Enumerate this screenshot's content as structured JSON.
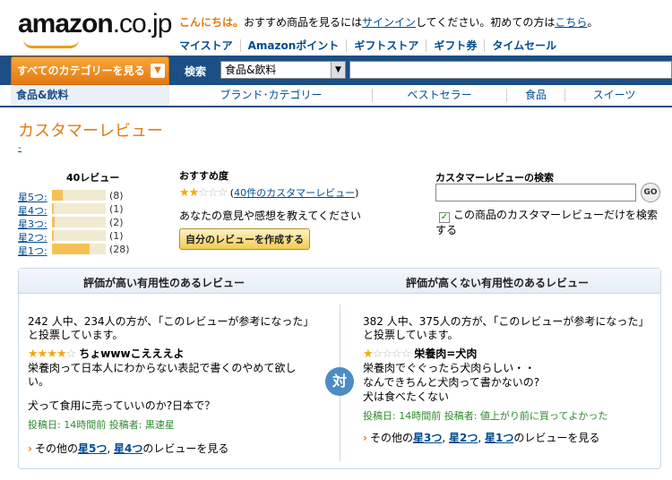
{
  "header": {
    "logo_main": "amazon",
    "logo_tld": ".co.jp",
    "greeting_hello": "こんにちは。",
    "greeting_text": "おすすめ商品を見るには",
    "signin_link": "サインイン",
    "greeting_text2": "してください。初めての方は",
    "here_link": "こちら",
    "greeting_end": "。",
    "nav": [
      "マイストア",
      "Amazonポイント",
      "ギフトストア",
      "ギフト券",
      "タイムセール"
    ]
  },
  "searchbar": {
    "category_button": "すべてのカテゴリーを見る",
    "label": "検索",
    "selected_category": "食品&飲料",
    "query": ""
  },
  "subnav": {
    "current": "食品&飲料",
    "tabs": [
      "ブランド･カテゴリー",
      "ベストセラー",
      "食品",
      "スイーツ"
    ]
  },
  "page": {
    "title": "カスタマーレビュー",
    "dash": "-"
  },
  "histogram": {
    "total": "40レビュー",
    "rows": [
      {
        "label": "星5つ:",
        "count": "(8)",
        "fraction": 0.2
      },
      {
        "label": "星4つ:",
        "count": "(1)",
        "fraction": 0.025
      },
      {
        "label": "星3つ:",
        "count": "(2)",
        "fraction": 0.05
      },
      {
        "label": "星2つ:",
        "count": "(1)",
        "fraction": 0.025
      },
      {
        "label": "星1つ:",
        "count": "(28)",
        "fraction": 0.7
      }
    ]
  },
  "recommend": {
    "title": "おすすめ度",
    "stars": 2,
    "link": "40件のカスタマーレビュー",
    "ask": "あなたの意見や感想を教えてください",
    "write_button": "自分のレビューを作成する"
  },
  "review_search": {
    "title": "カスタマーレビューの検索",
    "query": "",
    "go": "GO",
    "checkbox_checked": true,
    "checkbox_label": "この商品のカスタマーレビューだけを検索する"
  },
  "comparison": {
    "left_header": "評価が高い有用性のあるレビュー",
    "right_header": "評価が高くない有用性のあるレビュー",
    "vs": "対",
    "left": {
      "helpful": "242 人中、234人の方が、「このレビューが参考になった」と投票しています。",
      "stars": 4,
      "title": "ちょwwwこえええよ",
      "body1": "栄養肉って日本人にわからない表記で書くのやめて欲しい。",
      "body2": "犬って食用に売っていいのか?日本で？",
      "meta": "投稿日: 14時間前 投稿者: 黒速星",
      "more_prefix": "その他の",
      "more_link1": "星5つ",
      "more_sep": ", ",
      "more_link2": "星4つ",
      "more_suffix": "のレビューを見る"
    },
    "right": {
      "helpful": "382 人中、375人の方が、「このレビューが参考になった」と投票しています。",
      "stars": 1,
      "title": "栄養肉=犬肉",
      "body1": "栄養肉でぐぐったら犬肉らしい・・",
      "body2": "なんできちんと犬肉って書かないの?",
      "body3": "犬は食べたくない",
      "meta": "投稿日: 14時間前 投稿者: 値上がり前に買ってよかった",
      "more_prefix": "その他の",
      "more_link1": "星3つ",
      "more_sep1": ", ",
      "more_link2": "星2つ",
      "more_sep2": ", ",
      "more_link3": "星1つ",
      "more_suffix": "のレビューを見る"
    }
  },
  "colors": {
    "brand_orange": "#e47911",
    "nav_blue": "#1b4f86",
    "link_blue": "#004b91",
    "star_gold": "#f1a90a",
    "meta_green": "#2e8b2e"
  }
}
